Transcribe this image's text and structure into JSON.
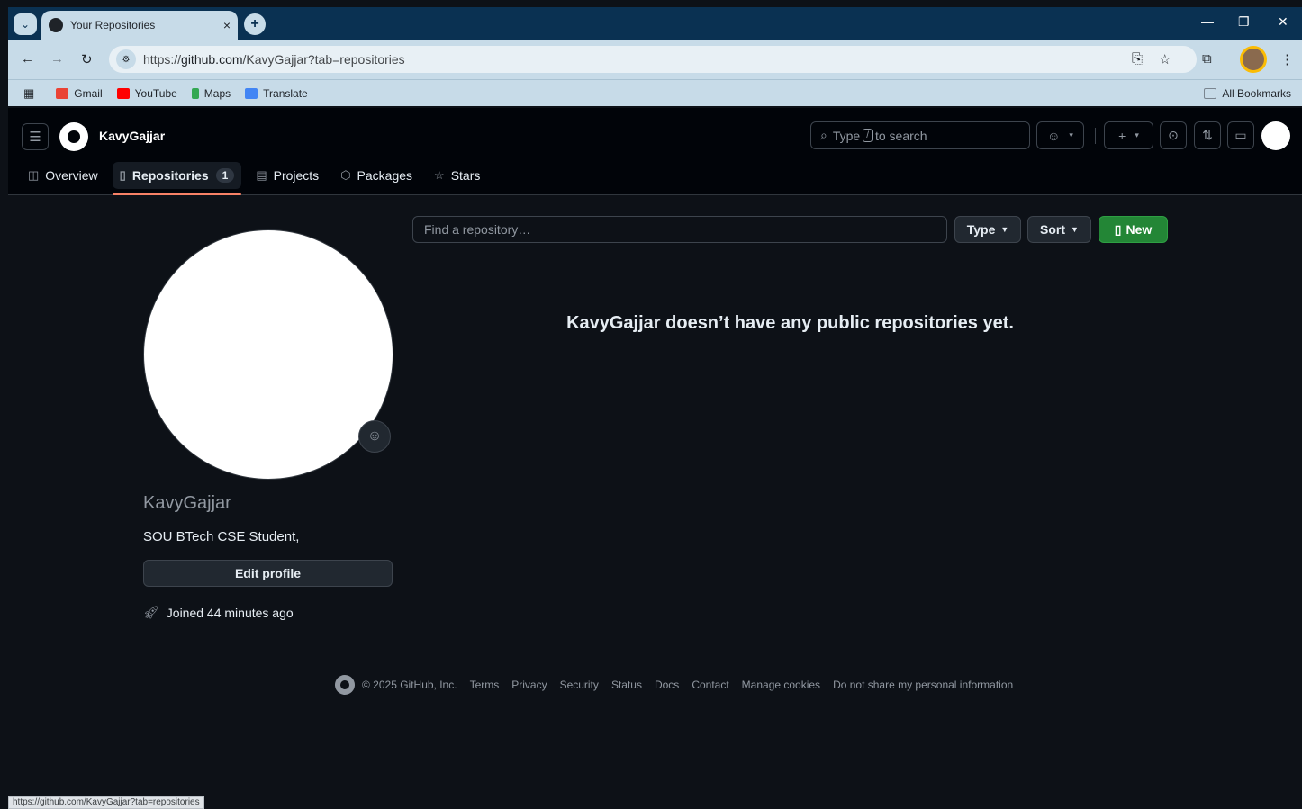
{
  "browser": {
    "tab_title": "Your Repositories",
    "tab_close": "×",
    "new_tab": "+",
    "url_prefix": "https://",
    "url_host": "github.com",
    "url_path": "/KavyGajjar?tab=repositories",
    "win_min": "—",
    "win_restore": "❐",
    "win_close": "✕",
    "bookmarks": [
      {
        "label": "Gmail",
        "color": "#ea4335"
      },
      {
        "label": "YouTube",
        "color": "#ff0000"
      },
      {
        "label": "Maps",
        "color": "#34a853"
      },
      {
        "label": "Translate",
        "color": "#4285f4"
      }
    ],
    "all_bookmarks": "All Bookmarks",
    "status_url": "https://github.com/KavyGajjar?tab=repositories"
  },
  "header": {
    "username": "KavyGajjar",
    "search_pre": "Type",
    "search_key": "/",
    "search_post": "to search"
  },
  "tabs": [
    {
      "label": "Overview",
      "icon": "book-icon"
    },
    {
      "label": "Repositories",
      "icon": "repo-icon",
      "count": "1"
    },
    {
      "label": "Projects",
      "icon": "table-icon"
    },
    {
      "label": "Packages",
      "icon": "package-icon"
    },
    {
      "label": "Stars",
      "icon": "star-icon"
    }
  ],
  "profile": {
    "name": "KavyGajjar",
    "bio": "SOU BTech CSE Student,",
    "edit_label": "Edit profile",
    "joined": "Joined 44 minutes ago"
  },
  "repos": {
    "find_placeholder": "Find a repository…",
    "type_label": "Type",
    "sort_label": "Sort",
    "new_label": "New",
    "blank_message": "KavyGajjar doesn’t have any public repositories yet."
  },
  "footer": {
    "copyright": "© 2025 GitHub, Inc.",
    "links": [
      "Terms",
      "Privacy",
      "Security",
      "Status",
      "Docs",
      "Contact",
      "Manage cookies",
      "Do not share my personal information"
    ]
  },
  "colors": {
    "accent_green": "#238636",
    "tab_underline": "#f78166",
    "bg": "#0d1117"
  }
}
